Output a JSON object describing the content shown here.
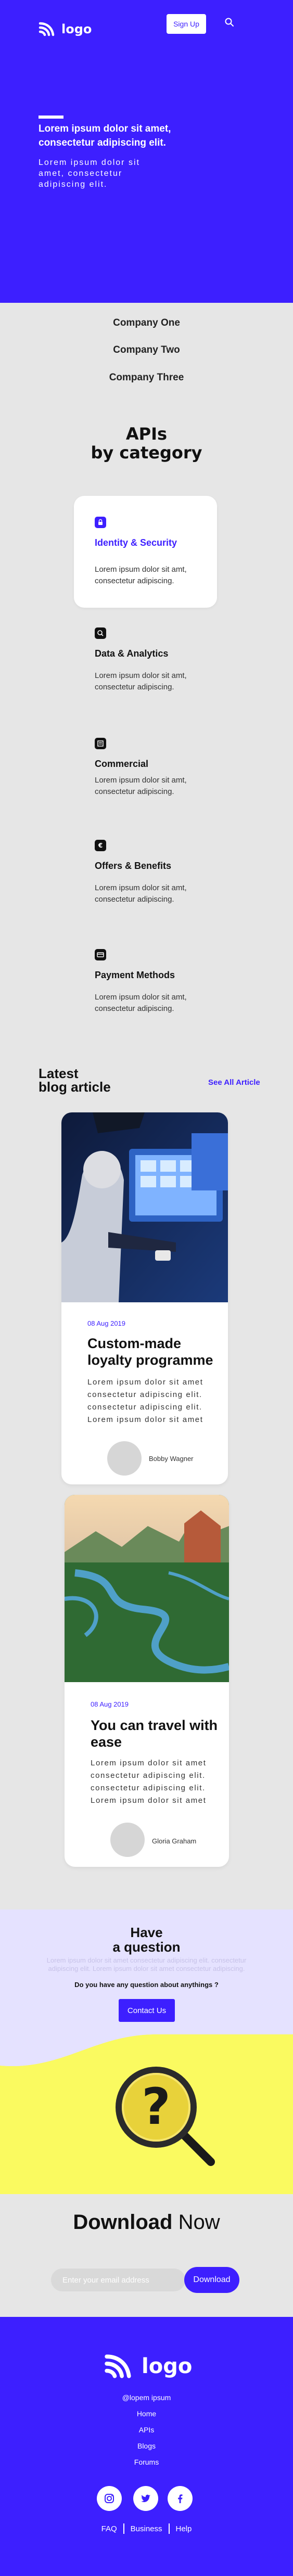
{
  "header": {
    "logo_text": "logo",
    "signup_label": "Sign Up",
    "search_icon": "search-icon"
  },
  "hero": {
    "title": "Lorem ipsum dolor sit amet, consectetur adipiscing elit.",
    "text": "Lorem ipsum dolor sit amet, consectetur adipiscing elit."
  },
  "companies": [
    "Company One",
    "Company Two",
    "Company Three"
  ],
  "apis": {
    "title": "APIs by category",
    "title_line1": "APIs",
    "title_line2": "by category",
    "items": [
      {
        "title": "Identity & Security",
        "desc": "Lorem ipsum dolor sit amt, consectetur adipiscing.",
        "icon": "lock-icon",
        "active": true
      },
      {
        "title": "Data & Analytics",
        "desc": "Lorem ipsum dolor sit amt, consectetur adipiscing.",
        "icon": "search-icon",
        "active": false
      },
      {
        "title": "Commercial",
        "desc": "Lorem ipsum dolor sit amt, consectetur adipiscing.",
        "icon": "document-icon",
        "active": false
      },
      {
        "title": "Offers & Benefits",
        "desc": "Lorem ipsum dolor sit amt, consectetur adipiscing.",
        "icon": "tag-icon",
        "active": false
      },
      {
        "title": "Payment Methods",
        "desc": "Lorem ipsum dolor sit amt, consectetur adipiscing.",
        "icon": "card-icon",
        "active": false
      }
    ]
  },
  "blog": {
    "title_line1": "Latest",
    "title_line2": "blog article",
    "see_all": "See All Article",
    "posts": [
      {
        "date": "08 Aug 2019",
        "title": "Custom-made loyalty programme",
        "text": "Lorem ipsum dolor sit amet consectetur adipiscing elit. consectetur adipiscing elit. Lorem ipsum dolor sit amet",
        "author": "Bobby Wagner"
      },
      {
        "date": "08 Aug 2019",
        "title": "You can travel with ease",
        "text": "Lorem ipsum dolor sit amet consectetur adipiscing elit. consectetur adipiscing elit. Lorem ipsum dolor sit amet",
        "author": "Gloria Graham"
      }
    ]
  },
  "question": {
    "title_line1": "Have",
    "title_line2": "a question",
    "faded_text": "Lorem ipsum dolor sit amet consectetur adipiscing elit. consectetur adipiscing elit. Lorem ipsum dolor sit amet consectetur adipiscing.",
    "subtitle": "Do you have any question about anythings ?",
    "contact_label": "Contact Us"
  },
  "download": {
    "title_bold": "Download",
    "title_rest": " Now",
    "input_placeholder": "Enter your email address",
    "button_label": "Download"
  },
  "footer": {
    "logo_text": "logo",
    "handle": "@lopem ipsum",
    "links": [
      "Home",
      "APIs",
      "Blogs",
      "Forums"
    ],
    "bottom_links": [
      "FAQ",
      "Business",
      "Help"
    ],
    "socials": [
      "instagram-icon",
      "twitter-icon",
      "facebook-icon"
    ]
  },
  "colors": {
    "accent": "#3d1fff",
    "lavender": "#e5e2ff",
    "yellow": "#fafa60",
    "background": "#e6e6e6"
  }
}
